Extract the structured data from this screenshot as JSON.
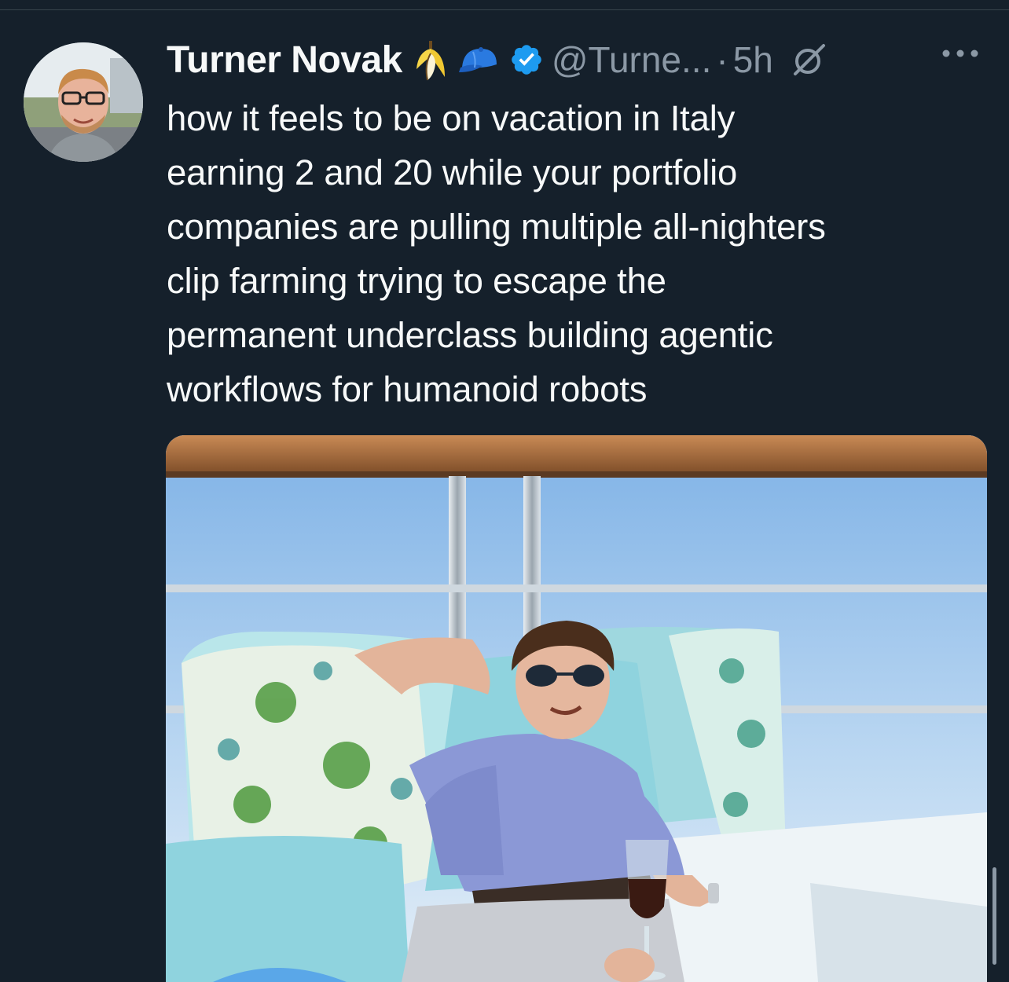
{
  "author": {
    "display_name": "Turner Novak",
    "handle": "@Turne...",
    "separator": "·",
    "time": "5h",
    "badges": [
      "banana-emoji-icon",
      "blue-cap-emoji-icon",
      "verified-badge-icon"
    ]
  },
  "tweet": {
    "text": "how it feels to be on vacation in Italy\nearning 2 and 20 while your portfolio\ncompanies are pulling multiple all-nighters\nclip farming trying to escape the\npermanent underclass building agentic\nworkflows for humanoid robots"
  },
  "media": {
    "kind": "photo",
    "subject": "man lounging on a yacht deck holding a glass of wine"
  },
  "icons": {
    "grok": "grok-icon",
    "more": "more-options-icon"
  },
  "colors": {
    "background": "#15202b",
    "text": "#f7f9f9",
    "secondary_text": "#8b98a5",
    "verified": "#1d9bf0"
  }
}
